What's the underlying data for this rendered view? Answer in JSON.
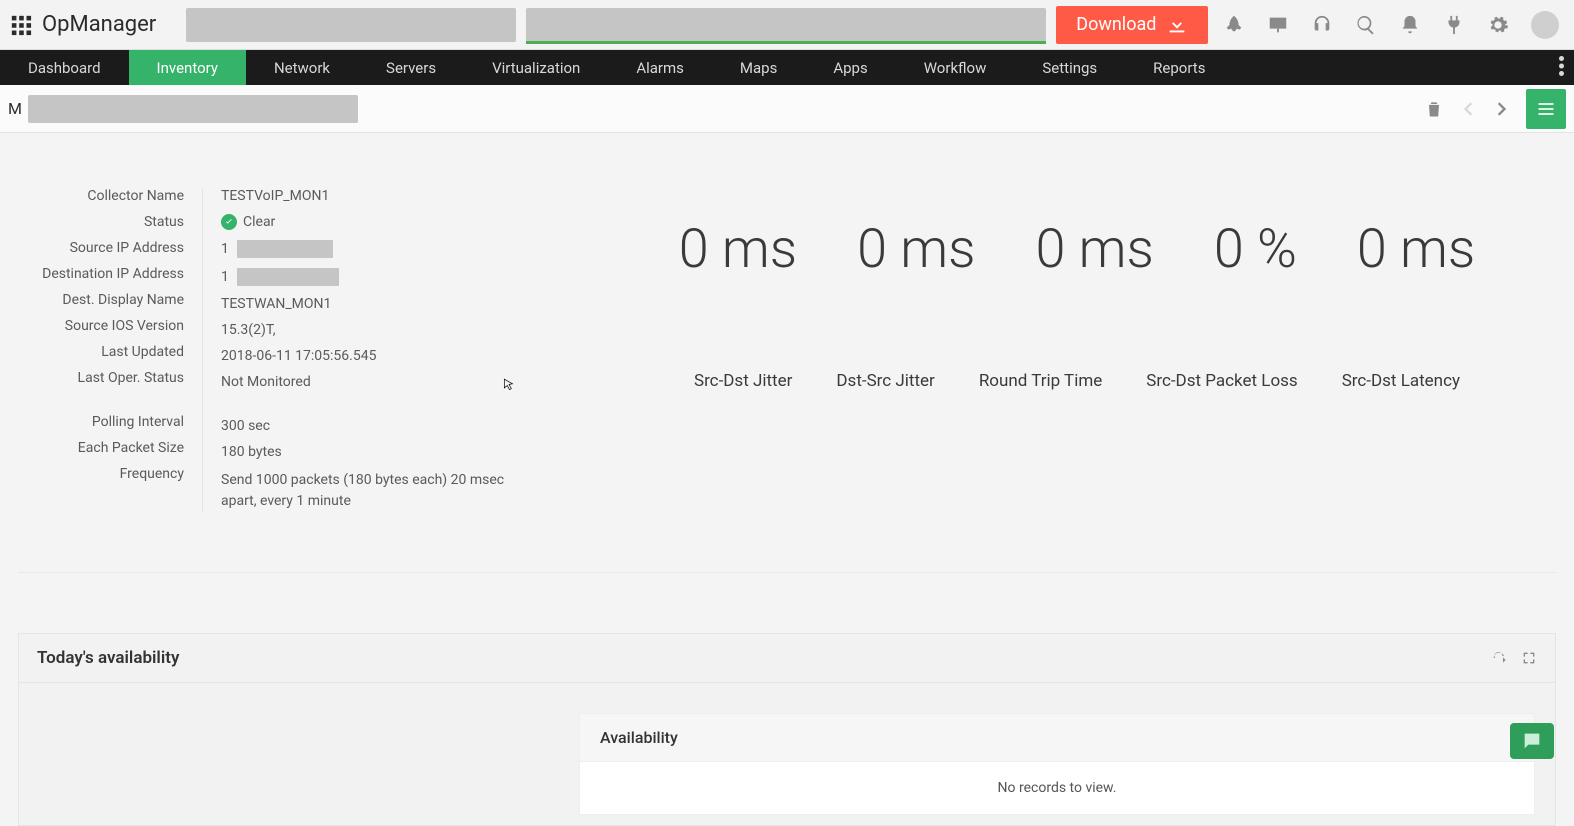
{
  "brand": "OpManager",
  "download_label": "Download",
  "nav": {
    "items": [
      "Dashboard",
      "Inventory",
      "Network",
      "Servers",
      "Virtualization",
      "Alarms",
      "Maps",
      "Apps",
      "Workflow",
      "Settings",
      "Reports"
    ],
    "active_index": 1
  },
  "subheader": {
    "prefix": "M"
  },
  "details": {
    "labels": [
      "Collector Name",
      "Status",
      "Source IP Address",
      "Destination IP Address",
      "Dest. Display Name",
      "Source IOS Version",
      "Last Updated",
      "Last Oper. Status",
      "Polling Interval",
      "Each Packet Size",
      "Frequency"
    ],
    "collector_name": "TESTVoIP_MON1",
    "status_text": "Clear",
    "source_ip_prefix": "1",
    "dest_ip_prefix": "1",
    "dest_display_name": "TESTWAN_MON1",
    "source_ios_version": "15.3(2)T,",
    "last_updated": "2018-06-11 17:05:56.545",
    "last_oper_status": "Not Monitored",
    "polling_interval": "300 sec",
    "packet_size": "180 bytes",
    "frequency": "Send 1000 packets (180 bytes each) 20 msec apart, every 1 minute"
  },
  "metrics": {
    "values": [
      "0 ms",
      "0 ms",
      "0 ms",
      "0 %",
      "0 ms"
    ],
    "labels": [
      "Src-Dst Jitter",
      "Dst-Src Jitter",
      "Round Trip Time",
      "Src-Dst Packet Loss",
      "Src-Dst Latency"
    ]
  },
  "availability_card": {
    "title": "Today's availability",
    "subtable_title": "Availability",
    "no_records": "No records to view."
  }
}
